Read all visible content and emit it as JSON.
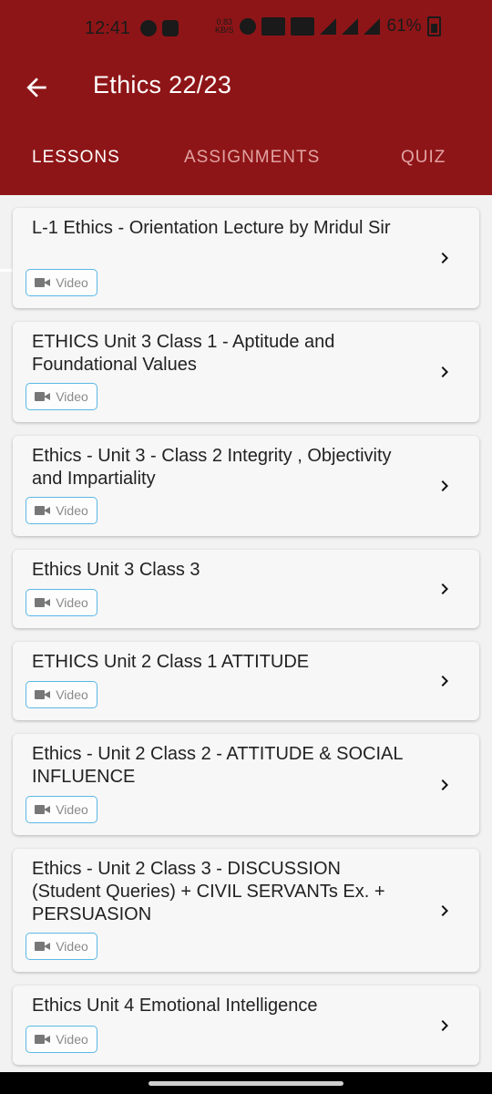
{
  "status_bar": {
    "time": "12:41",
    "speed": "0.83",
    "speed_unit": "KB/S",
    "battery": "61%"
  },
  "app_bar": {
    "title": "Ethics 22/23",
    "back_icon": "arrow-left-icon"
  },
  "tabs": [
    {
      "label": "LESSONS",
      "active": true
    },
    {
      "label": "ASSIGNMENTS",
      "active": false
    },
    {
      "label": "QUIZ",
      "active": false
    }
  ],
  "lessons": [
    {
      "title": "L-1 Ethics - Orientation Lecture by Mridul Sir",
      "type": "Video"
    },
    {
      "title": "ETHICS Unit 3 Class 1 - Aptitude and Foundational Values",
      "type": "Video"
    },
    {
      "title": "Ethics - Unit 3 - Class 2 Integrity , Objectivity and Impartiality",
      "type": "Video"
    },
    {
      "title": "Ethics Unit 3 Class 3",
      "type": "Video"
    },
    {
      "title": "ETHICS Unit 2 Class 1 ATTITUDE",
      "type": "Video"
    },
    {
      "title": "Ethics - Unit 2 Class 2 - ATTITUDE & SOCIAL INFLUENCE",
      "type": "Video"
    },
    {
      "title": "Ethics - Unit 2 Class 3 - DISCUSSION (Student Queries) + CIVIL SERVANTs Ex. + PERSUASION",
      "type": "Video"
    },
    {
      "title": "Ethics Unit 4 Emotional Intelligence",
      "type": "Video"
    }
  ],
  "colors": {
    "primary": "#8e1517",
    "chip_border": "#5bb8e6"
  }
}
